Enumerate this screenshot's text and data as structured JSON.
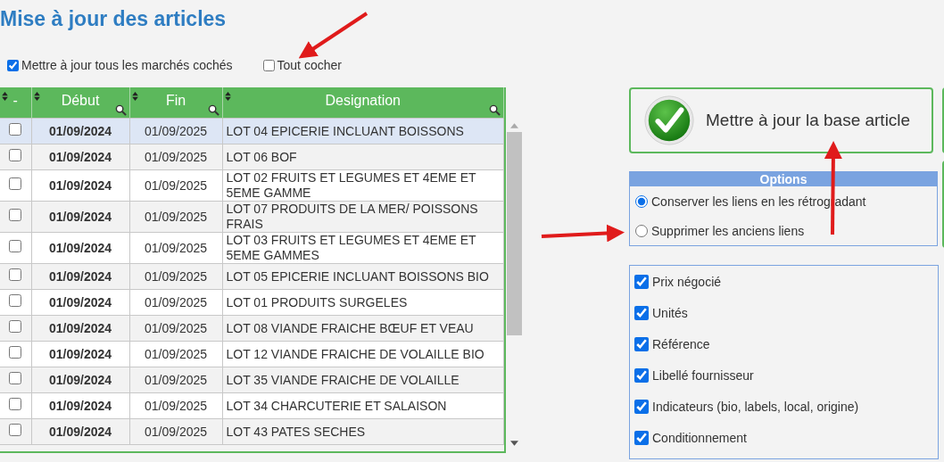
{
  "title": "Mise à jour des articles",
  "top_options": [
    {
      "label": "Mettre à jour tous les marchés cochés",
      "checked": true
    },
    {
      "label": "Tout cocher",
      "checked": false
    }
  ],
  "table": {
    "columns": [
      "-",
      "Début",
      "Fin",
      "Designation"
    ],
    "rows": [
      {
        "checked": false,
        "selected": true,
        "start": "01/09/2024",
        "end": "01/09/2025",
        "designation": "LOT 04 EPICERIE INCLUANT BOISSONS"
      },
      {
        "checked": false,
        "selected": false,
        "start": "01/09/2024",
        "end": "01/09/2025",
        "designation": "LOT 06 BOF"
      },
      {
        "checked": false,
        "selected": false,
        "start": "01/09/2024",
        "end": "01/09/2025",
        "designation": "LOT 02 FRUITS ET LEGUMES ET 4EME ET 5EME GAMME"
      },
      {
        "checked": false,
        "selected": false,
        "start": "01/09/2024",
        "end": "01/09/2025",
        "designation": "LOT 07 PRODUITS DE LA MER/ POISSONS FRAIS"
      },
      {
        "checked": false,
        "selected": false,
        "start": "01/09/2024",
        "end": "01/09/2025",
        "designation": "LOT 03 FRUITS ET LEGUMES ET 4EME ET 5EME GAMMES"
      },
      {
        "checked": false,
        "selected": false,
        "start": "01/09/2024",
        "end": "01/09/2025",
        "designation": "LOT 05 EPICERIE INCLUANT BOISSONS BIO"
      },
      {
        "checked": false,
        "selected": false,
        "start": "01/09/2024",
        "end": "01/09/2025",
        "designation": "LOT 01 PRODUITS SURGELES"
      },
      {
        "checked": false,
        "selected": false,
        "start": "01/09/2024",
        "end": "01/09/2025",
        "designation": "LOT 08 VIANDE FRAICHE BŒUF ET VEAU"
      },
      {
        "checked": false,
        "selected": false,
        "start": "01/09/2024",
        "end": "01/09/2025",
        "designation": "LOT 12 VIANDE FRAICHE DE VOLAILLE BIO"
      },
      {
        "checked": false,
        "selected": false,
        "start": "01/09/2024",
        "end": "01/09/2025",
        "designation": "LOT 35 VIANDE FRAICHE DE VOLAILLE"
      },
      {
        "checked": false,
        "selected": false,
        "start": "01/09/2024",
        "end": "01/09/2025",
        "designation": "LOT 34 CHARCUTERIE ET SALAISON"
      },
      {
        "checked": false,
        "selected": false,
        "start": "01/09/2024",
        "end": "01/09/2025",
        "designation": "LOT 43 PATES SECHES"
      }
    ]
  },
  "update_button": {
    "label": "Mettre à jour la base article"
  },
  "options": {
    "title": "Options",
    "choices": [
      {
        "label": "Conserver les liens en les rétrogradant",
        "selected": true
      },
      {
        "label": "Supprimer les anciens liens",
        "selected": false
      }
    ]
  },
  "fields": [
    {
      "label": "Prix négocié",
      "checked": true
    },
    {
      "label": "Unités",
      "checked": true
    },
    {
      "label": "Référence",
      "checked": true
    },
    {
      "label": "Libellé fournisseur",
      "checked": true
    },
    {
      "label": "Indicateurs (bio, labels, local, origine)",
      "checked": true
    },
    {
      "label": "Conditionnement",
      "checked": true
    }
  ]
}
